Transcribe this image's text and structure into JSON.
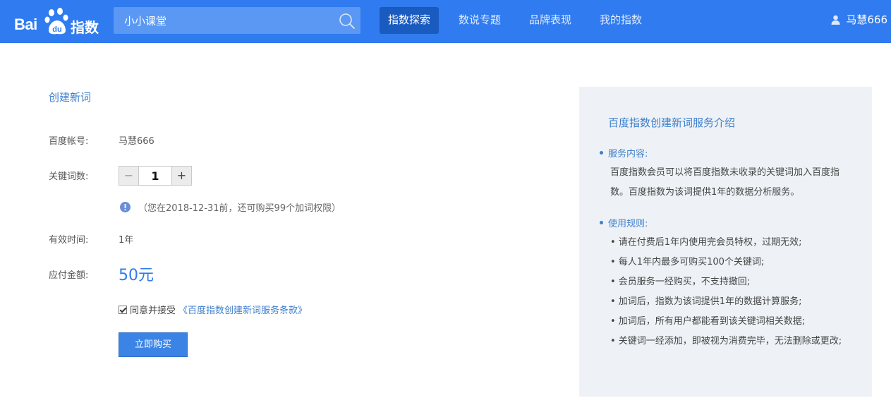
{
  "header": {
    "logo_text_bai": "Bai",
    "logo_text_du": "du",
    "logo_text_zhishu": "指数",
    "search": {
      "value": "小小课堂",
      "icon": "search-icon"
    },
    "nav": [
      {
        "label": "指数探索",
        "active": true
      },
      {
        "label": "数说专题",
        "active": false
      },
      {
        "label": "品牌表现",
        "active": false
      },
      {
        "label": "我的指数",
        "active": false
      }
    ],
    "user": {
      "name": "马慧666",
      "icon": "user-icon"
    }
  },
  "form": {
    "title": "创建新词",
    "account_label": "百度帐号:",
    "account_value": "马慧666",
    "count_label": "关键词数:",
    "count_value": "1",
    "minus_label": "−",
    "plus_label": "+",
    "notice": "（您在2018-12-31前，还可购买99个加词权限）",
    "validity_label": "有效时间:",
    "validity_value": "1年",
    "amount_label": "应付金额:",
    "amount_value": "50元",
    "agree_checked": true,
    "agree_text": "同意并接受",
    "agree_link": "《百度指数创建新词服务条款》",
    "buy_label": "立即购买"
  },
  "panel": {
    "title": "百度指数创建新词服务介绍",
    "content_heading": "服务内容:",
    "content_text": "百度指数会员可以将百度指数未收录的关键词加入百度指数。百度指数为该词提供1年的数据分析服务。",
    "rules_heading": "使用规则:",
    "rules": [
      "• 请在付费后1年内使用完会员特权，过期无效;",
      "• 每人1年内最多可购买100个关键词;",
      "• 会员服务一经购买，不支持撤回;",
      "• 加词后，指数为该词提供1年的数据计算服务;",
      "• 加词后，所有用户都能看到该关键词相关数据;",
      "• 关键词一经添加，即被视为消费完毕，无法删除或更改;"
    ]
  },
  "colors": {
    "header_bg": "#2f7bef",
    "accent": "#3b7ecc",
    "price": "#2f7bef",
    "panel_bg": "#eef2f6"
  }
}
